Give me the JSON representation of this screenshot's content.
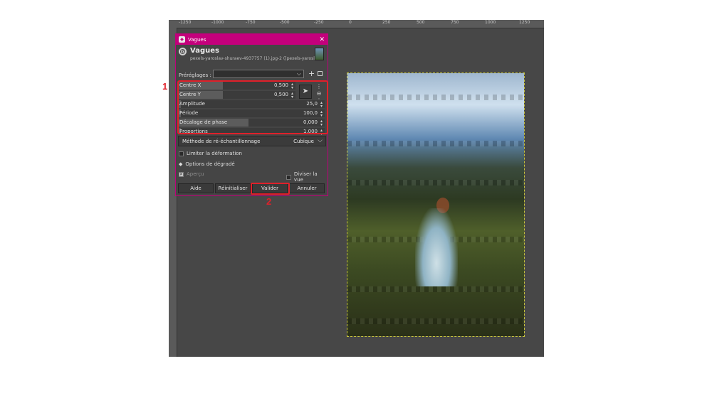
{
  "ruler": {
    "labels": [
      "-1250",
      "-1000",
      "-750",
      "-500",
      "-250",
      "0",
      "250",
      "500",
      "750",
      "1000",
      "1250"
    ]
  },
  "dialog": {
    "window_title": "Vagues",
    "header_title": "Vagues",
    "header_subtitle": "pexels-yaroslav-shuraev-4937757 (1).jpg-2 ([pexels-yarosla...",
    "presets_label": "Préréglages :",
    "presets_value": "",
    "params": [
      {
        "label": "Centre X",
        "value": "0,500",
        "fill_fraction": 0.38
      },
      {
        "label": "Centre Y",
        "value": "0,500",
        "fill_fraction": 0.38
      },
      {
        "label": "Amplitude",
        "value": "25,0",
        "fill_fraction": 0.02
      },
      {
        "label": "Période",
        "value": "100,0",
        "fill_fraction": 0.02
      },
      {
        "label": "Décalage de phase",
        "value": "0,000",
        "fill_fraction": 0.48
      },
      {
        "label": "Proportions",
        "value": "1,000",
        "fill_fraction": 0.02
      }
    ],
    "resample_label": "Méthode de ré-échantillonnage",
    "resample_value": "Cubique",
    "limit_label": "Limiter la déformation",
    "gradient_label": "Options de dégradé",
    "preview_label": "Aperçu",
    "split_label": "Diviser la vue",
    "buttons": {
      "help": "Aide",
      "reset": "Réinitialiser",
      "ok": "Valider",
      "cancel": "Annuler"
    }
  },
  "annotations": {
    "marker1": "1",
    "marker2": "2"
  },
  "colors": {
    "accent": "#c4007c",
    "highlight": "#e0202a"
  }
}
